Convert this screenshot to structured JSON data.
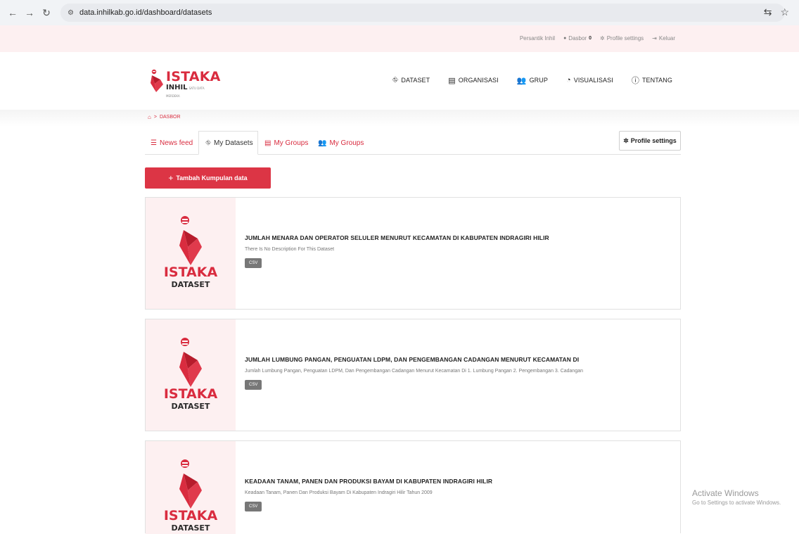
{
  "browser": {
    "url": "data.inhilkab.go.id/dashboard/datasets"
  },
  "util_bar": {
    "user_name": "Persantik Inhil",
    "dashboard_label": "Dasbor",
    "dashboard_count": "0",
    "profile_settings_label": "Profile settings",
    "logout_label": "Keluar"
  },
  "logo": {
    "title": "ISTAKA",
    "subtitle": "INHIL",
    "tagline": "SATU DATA MERDEKA"
  },
  "nav": {
    "items": [
      {
        "label": "DATASET",
        "icon": "sitemap-icon"
      },
      {
        "label": "ORGANISASI",
        "icon": "building-icon"
      },
      {
        "label": "GRUP",
        "icon": "users-icon"
      },
      {
        "label": "VISUALISASI",
        "icon": "pie-chart-icon"
      },
      {
        "label": "TENTANG",
        "icon": "info-circle-icon"
      }
    ]
  },
  "breadcrumb": {
    "separator": ">",
    "current": "DASBOR"
  },
  "tabs": [
    {
      "label": "News feed",
      "icon": "list-icon"
    },
    {
      "label": "My Datasets",
      "icon": "sitemap-icon"
    },
    {
      "label": "My Groups",
      "icon": "building-icon"
    },
    {
      "label": "My Groups",
      "icon": "users-icon"
    }
  ],
  "profile_button": {
    "label": "Profile settings",
    "icon": "gear-icon"
  },
  "add_button": {
    "label": "Tambah Kumpulan data",
    "icon": "plus-icon"
  },
  "thumb": {
    "title": "ISTAKA",
    "subtitle": "DATASET"
  },
  "datasets": [
    {
      "title": "JUMLAH MENARA DAN OPERATOR SELULER MENURUT KECAMATAN DI KABUPATEN INDRAGIRI HILIR",
      "description": "There Is No Description For This Dataset",
      "format": "CSV"
    },
    {
      "title": "JUMLAH LUMBUNG PANGAN, PENGUATAN LDPM, DAN PENGEMBANGAN CADANGAN MENURUT KECAMATAN DI",
      "description": "Jumlah Lumbung Pangan, Penguatan LDPM, Dan Pengembangan Cadangan Menurut Kecamatan Di 1. Lumbung Pangan 2. Pengembangan 3. Cadangan",
      "format": "CSV"
    },
    {
      "title": "KEADAAN TANAM, PANEN DAN PRODUKSI BAYAM DI KABUPATEN INDRAGIRI HILIR",
      "description": "Keadaan Tanam, Panen Dan Produksi Bayam Di Kabupaten Indragiri Hilir Tahun 2009",
      "format": "CSV"
    }
  ],
  "watermark": {
    "line1": "Activate Windows",
    "line2": "Go to Settings to activate Windows."
  },
  "colors": {
    "brand_red": "#d92c3f",
    "button_red": "#dc3545",
    "band_pink": "#fdf0f1"
  }
}
